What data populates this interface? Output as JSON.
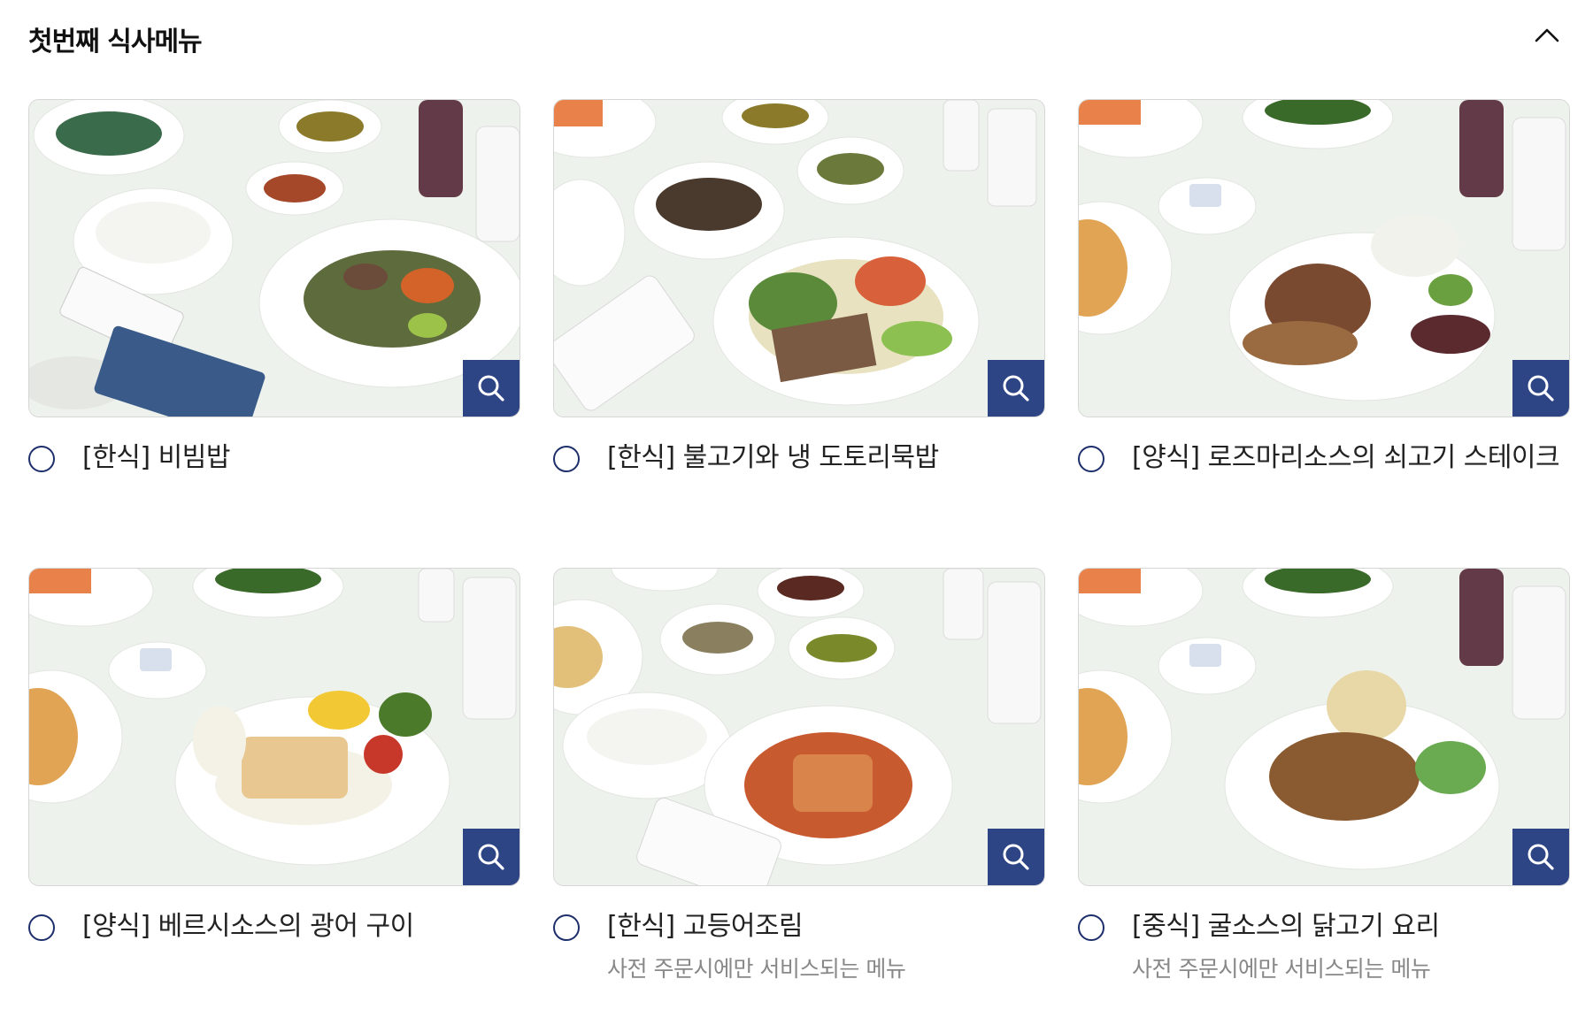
{
  "section": {
    "title": "첫번째 식사메뉴",
    "collapse_icon": "chevron-up-icon"
  },
  "colors": {
    "zoom_button": "#2d4485",
    "radio_border": "#1d2f6b",
    "note_text": "#888888"
  },
  "meals": [
    {
      "label": "[한식] 비빔밥",
      "note": ""
    },
    {
      "label": "[한식] 불고기와 냉 도토리묵밥",
      "note": ""
    },
    {
      "label": "[양식] 로즈마리소스의 쇠고기 스테이크",
      "note": ""
    },
    {
      "label": "[양식] 베르시소스의 광어 구이",
      "note": ""
    },
    {
      "label": "[한식] 고등어조림",
      "note": "사전 주문시에만 서비스되는 메뉴"
    },
    {
      "label": "[중식] 굴소스의 닭고기 요리",
      "note": "사전 주문시에만 서비스되는 메뉴"
    }
  ]
}
